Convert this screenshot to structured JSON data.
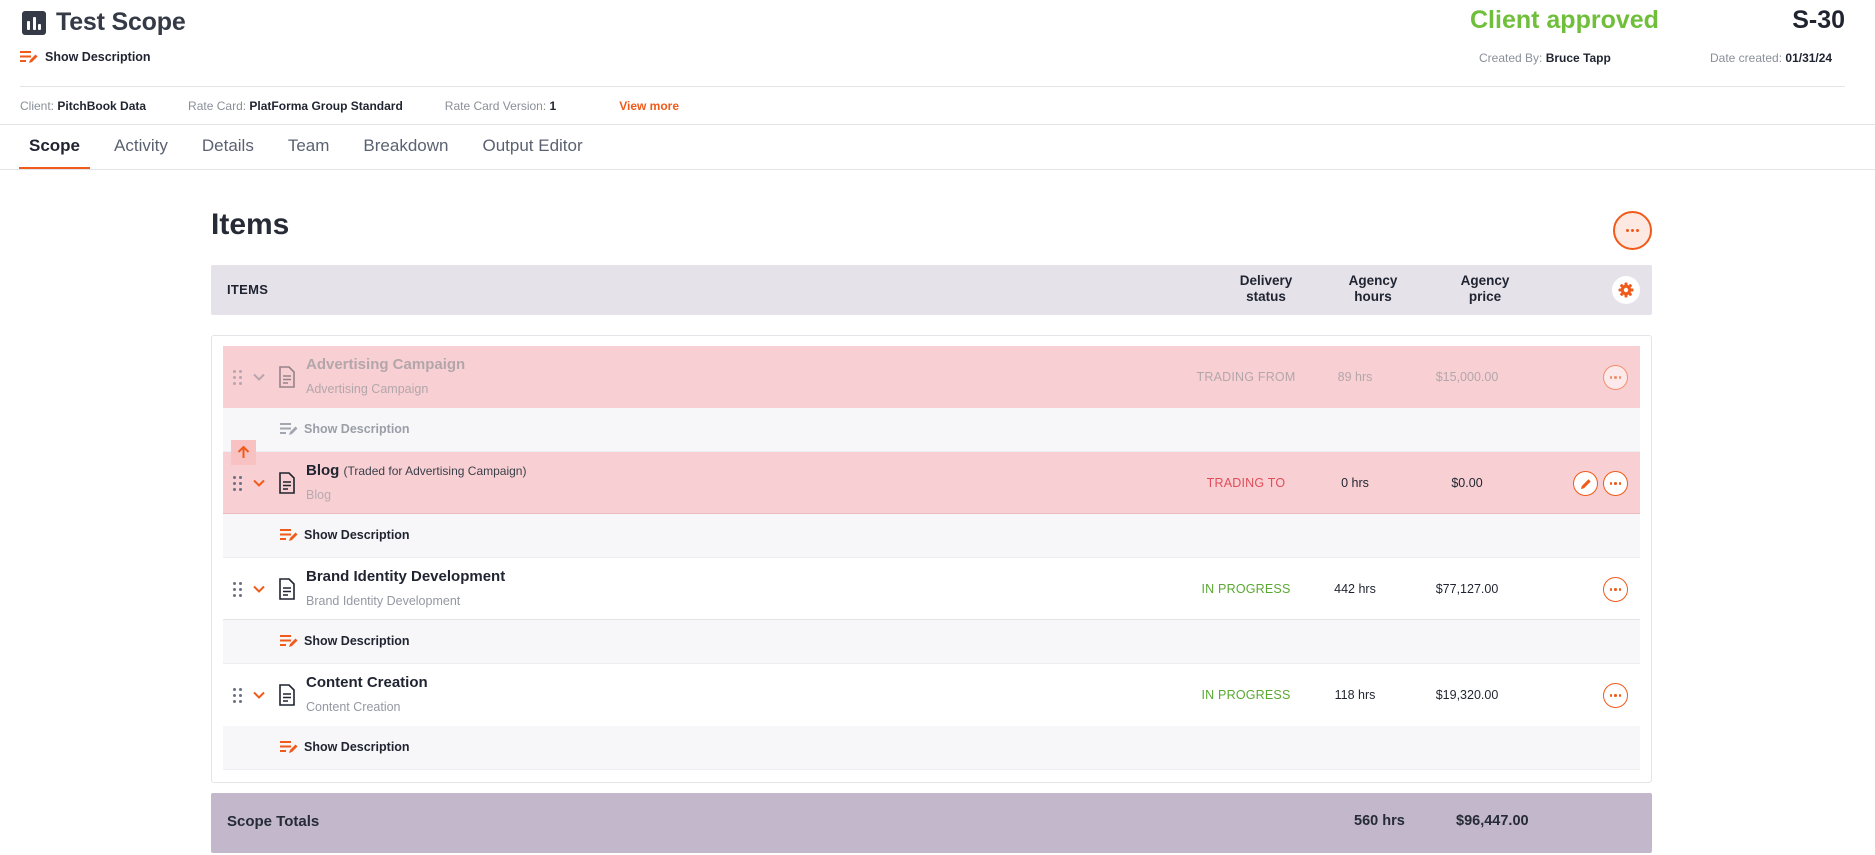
{
  "header": {
    "title": "Test Scope",
    "show_description": "Show Description",
    "status": "Client approved",
    "scope_id": "S-30",
    "created_by_label": "Created By:",
    "created_by": "Bruce Tapp",
    "date_created_label": "Date created:",
    "date_created": "01/31/24"
  },
  "info": {
    "client_label": "Client:",
    "client": "PitchBook Data",
    "rate_card_label": "Rate Card:",
    "rate_card": "PlatForma Group Standard",
    "rate_card_version_label": "Rate Card Version:",
    "rate_card_version": "1",
    "view_more": "View more"
  },
  "tabs": [
    "Scope",
    "Activity",
    "Details",
    "Team",
    "Breakdown",
    "Output Editor"
  ],
  "items_section": {
    "title": "Items",
    "columns": {
      "items": "ITEMS",
      "delivery_status_1": "Delivery",
      "delivery_status_2": "status",
      "agency_hours_1": "Agency",
      "agency_hours_2": "hours",
      "agency_price_1": "Agency",
      "agency_price_2": "price"
    },
    "rows": [
      {
        "title": "Advertising Campaign",
        "note": "",
        "subtitle": "Advertising Campaign",
        "status": "TRADING FROM",
        "hours": "89 hrs",
        "price": "$15,000.00",
        "description_label": "Show Description"
      },
      {
        "title": "Blog",
        "note": "(Traded for Advertising Campaign)",
        "subtitle": "Blog",
        "status": "TRADING TO",
        "hours": "0 hrs",
        "price": "$0.00",
        "description_label": "Show Description"
      },
      {
        "title": "Brand Identity Development",
        "note": "",
        "subtitle": "Brand Identity Development",
        "status": "IN PROGRESS",
        "hours": "442 hrs",
        "price": "$77,127.00",
        "description_label": "Show Description"
      },
      {
        "title": "Content Creation",
        "note": "",
        "subtitle": "Content Creation",
        "status": "IN PROGRESS",
        "hours": "118 hrs",
        "price": "$19,320.00",
        "description_label": "Show Description"
      }
    ],
    "totals": {
      "label": "Scope Totals",
      "hours": "560 hrs",
      "price": "$96,447.00"
    }
  },
  "colors": {
    "accent": "#f05a1a",
    "approved": "#6fbf3b",
    "in_progress": "#5aa832",
    "trading_to": "#e04e5b",
    "trading_from": "#b3a6aa",
    "row_trade": "#f8d0d3",
    "totals_bg": "#c2b7cb",
    "header_bg": "#e5e2ea"
  },
  "icons": {
    "app": "bar-chart-icon",
    "description": "notes-edit-icon",
    "drag": "drag-handle-icon",
    "expand": "chevron-down-icon",
    "document": "document-icon",
    "menu": "more-horizontal-icon",
    "edit": "pencil-icon",
    "settings": "gear-icon",
    "move_up": "arrow-up-icon"
  }
}
